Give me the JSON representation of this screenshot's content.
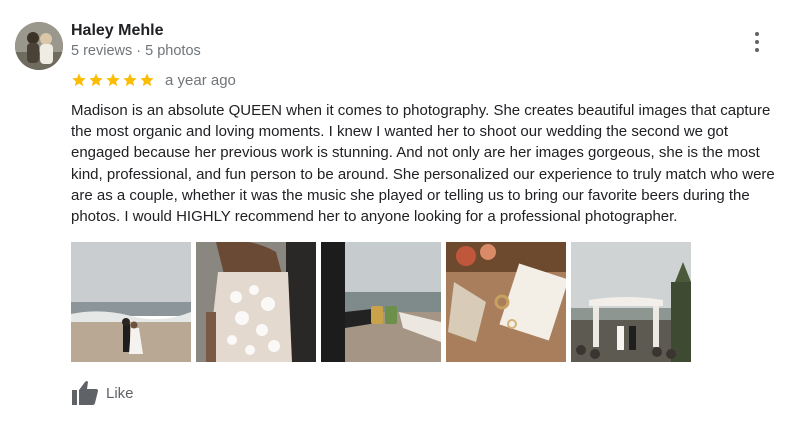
{
  "reviewer": {
    "name": "Haley Mehle",
    "meta": "5 reviews · 5 photos"
  },
  "rating": {
    "stars": 5,
    "max": 5,
    "date": "a year ago",
    "star_color": "#fbbc04"
  },
  "review_text": "Madison is an absolute QUEEN when it comes to photography. She creates beautiful images that capture the most organic and loving moments. I knew I wanted her to shoot our wedding the second we got engaged because her previous work is stunning. And not only are her images gorgeous, she is the most kind, professional, and fun person to be around. She personalized our experience to truly match who were are as a couple, whether it was the music she played or telling us to bring our favorite beers during the photos. I would HIGHLY recommend her to anyone looking for a professional photographer.",
  "photos": [
    {
      "subject": "couple-on-beach"
    },
    {
      "subject": "lace-dress-back"
    },
    {
      "subject": "beer-toast"
    },
    {
      "subject": "rings-and-invitation"
    },
    {
      "subject": "ceremony-arch"
    }
  ],
  "actions": {
    "like_label": "Like"
  }
}
